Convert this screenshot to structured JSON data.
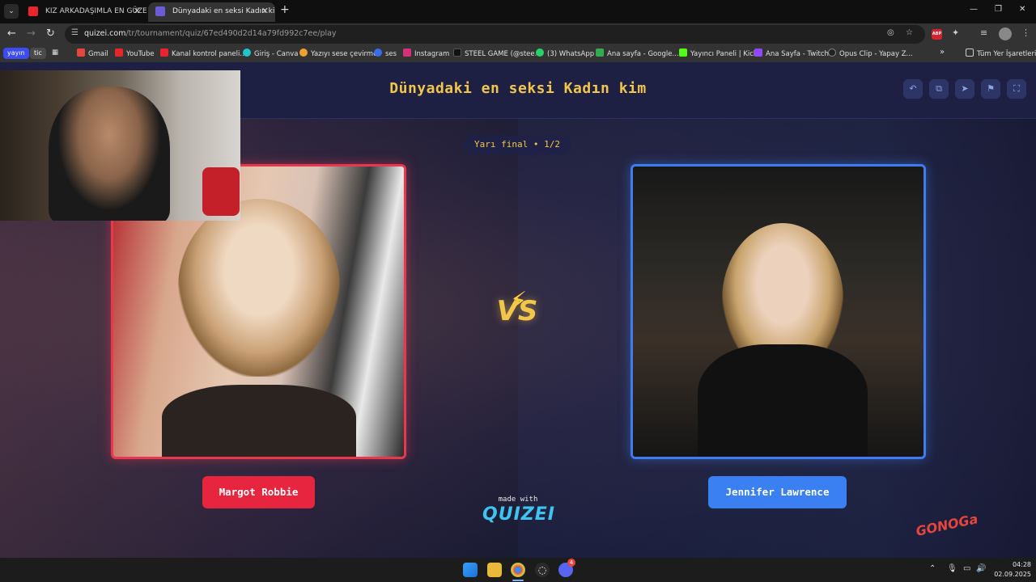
{
  "browser": {
    "tabs": [
      {
        "title": "KIZ ARKADAŞIMLA EN GÜZEL K",
        "active": false
      },
      {
        "title": "Dünyadaki en seksi Kadın kim",
        "active": true
      }
    ],
    "url_host": "quizei.com",
    "url_path": "/tr/tournament/quiz/67ed490d2d14a79fd992c7ee/play",
    "bookmarks": [
      "Gmail",
      "YouTube",
      "Kanal kontrol paneli...",
      "Giriş - Canva",
      "Yazıyı sese çevirme",
      "ses",
      "Instagram",
      "STEEL GAME (@stee...",
      "(3) WhatsApp",
      "Ana sayfa - Google...",
      "Yayıncı Paneli | Kick",
      "Ana Sayfa - Twitch",
      "Opus Clip - Yapay Z..."
    ],
    "bookmark_chips": [
      "yayın",
      "tic"
    ],
    "all_bookmarks": "Tüm Yer İşaretleri"
  },
  "quiz": {
    "title": "Dünyadaki en seksi Kadın kim",
    "round": "Yarı final • 1/2",
    "vs": "VS",
    "left_name": "Margot Robbie",
    "right_name": "Jennifer Lawrence",
    "made_with": "made with",
    "brand": "QUIZEI"
  },
  "overlay": {
    "watermark": "GONOGa"
  },
  "taskbar": {
    "time": "04:28",
    "date": "02.09.2025",
    "notification_badge": "4"
  },
  "colors": {
    "title_gold": "#f2c64a",
    "left_accent": "#e8253f",
    "right_accent": "#3a80f2",
    "header_bg": "#1d2043"
  }
}
